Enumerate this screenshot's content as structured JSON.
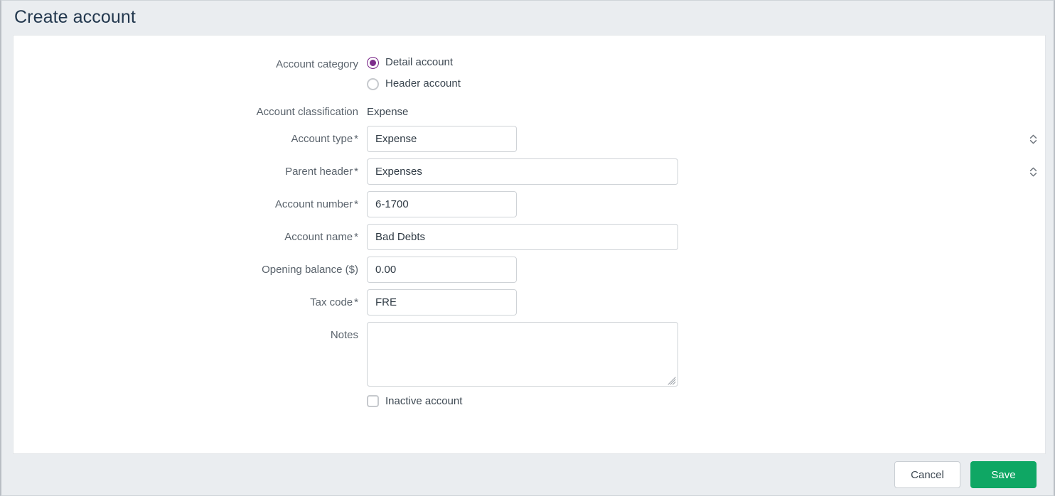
{
  "header": {
    "title": "Create account"
  },
  "form": {
    "account_category": {
      "label": "Account category",
      "options": [
        {
          "label": "Detail account",
          "selected": true
        },
        {
          "label": "Header account",
          "selected": false
        }
      ]
    },
    "account_classification": {
      "label": "Account classification",
      "value": "Expense"
    },
    "account_type": {
      "label": "Account type",
      "required_marker": "*",
      "value": "Expense",
      "icon": "chevron-updown-icon"
    },
    "parent_header": {
      "label": "Parent header",
      "required_marker": "*",
      "value": "Expenses",
      "icon": "chevron-updown-icon"
    },
    "account_number": {
      "label": "Account number",
      "required_marker": "*",
      "value": "6-1700",
      "placeholder": ""
    },
    "account_name": {
      "label": "Account name",
      "required_marker": "*",
      "value": "Bad Debts",
      "placeholder": ""
    },
    "opening_balance": {
      "label": "Opening balance ($)",
      "value": "0.00",
      "placeholder": ""
    },
    "tax_code": {
      "label": "Tax code",
      "required_marker": "*",
      "value": "FRE",
      "placeholder": "",
      "icon": "chevron-down-icon"
    },
    "notes": {
      "label": "Notes",
      "value": "",
      "placeholder": ""
    },
    "inactive_account": {
      "label": "Inactive account",
      "checked": false
    }
  },
  "footer": {
    "cancel_label": "Cancel",
    "save_label": "Save"
  },
  "colors": {
    "accent_purple": "#7e2d8c",
    "save_green": "#0fa764",
    "page_background": "#eaedf0",
    "card_background": "#ffffff",
    "label_text": "#5a636c",
    "title_text": "#23384e",
    "border": "#cfd3d7"
  }
}
